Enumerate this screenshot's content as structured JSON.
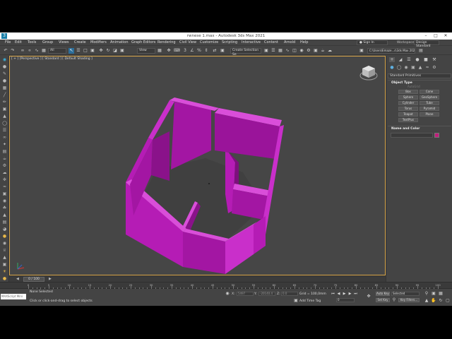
{
  "window": {
    "title": "rwnese 1.max - Autodesk 3ds Max 2021",
    "app_icon": "3ds-max-icon",
    "minimize": "–",
    "maximize": "□",
    "close": "✕"
  },
  "menu": {
    "items": [
      "File",
      "Edit",
      "Tools",
      "Group",
      "Views",
      "Create",
      "Modifiers",
      "Animation",
      "Graph Editors",
      "Rendering",
      "Civil View",
      "Customize",
      "Scripting",
      "Interactive",
      "Content",
      "Arnold",
      "Help"
    ],
    "sign_in": "Sign In",
    "workspaces_label": "Workspaces:",
    "workspace_value": "Design Standard"
  },
  "toolbar": {
    "selection_filter": "All",
    "reference_coord": "View",
    "selection_set": "Create Selection Se",
    "project_path": "C:\\Users\\Emaze...s\\3ds Max 2021"
  },
  "viewport": {
    "label": "[ + ] [Perspective ] [ Standard ] [ Default Shading ]",
    "object_color": "#b51cb5",
    "background": "#464646"
  },
  "command_panel": {
    "category": "Standard Primitives",
    "object_type_title": "Object Type",
    "autogrid": "AutoGrid",
    "buttons": [
      "Box",
      "Cone",
      "Sphere",
      "GeoSphere",
      "Cylinder",
      "Tube",
      "Torus",
      "Pyramid",
      "Teapot",
      "Plane",
      "TextPlus"
    ],
    "name_color_title": "Name and Color",
    "swatch_color": "#c21d7c"
  },
  "time_slider": {
    "frame": "0 / 100"
  },
  "timeline": {
    "ticks": [
      "0",
      "5",
      "10",
      "15",
      "20",
      "25",
      "30",
      "35",
      "40",
      "45",
      "50",
      "55",
      "60",
      "65",
      "70",
      "75",
      "80",
      "85",
      "90",
      "95",
      "100"
    ]
  },
  "status": {
    "maxscript": "MAXScript Mini",
    "selection": "None Selected",
    "prompt": "Click or click-and-drag to select objects",
    "x_label": "X:",
    "x_value": "5497",
    "y_label": "Y:",
    "y_value": "-20140.4",
    "z_label": "Z:",
    "z_value": "0.0",
    "grid": "Grid = 100,0mm",
    "add_time_tag": "Add Time Tag",
    "auto_key": "Auto Key",
    "set_key": "Set Key",
    "selected": "Selected",
    "key_filters": "Key Filters...",
    "frame_field": "0"
  }
}
